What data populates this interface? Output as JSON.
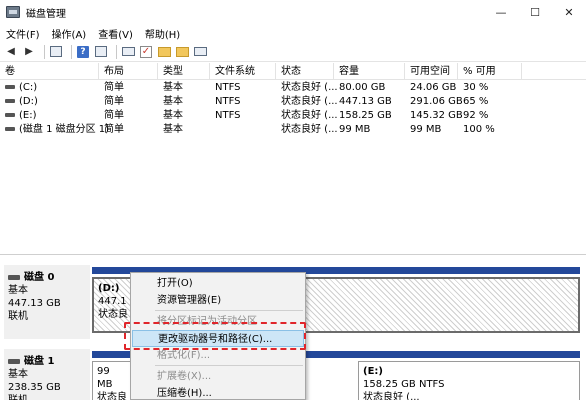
{
  "window": {
    "title": "磁盘管理",
    "min": "—",
    "max": "☐",
    "close": "✕"
  },
  "menu": [
    "文件(F)",
    "操作(A)",
    "查看(V)",
    "帮助(H)"
  ],
  "toolbar": {
    "back": "◀",
    "forward": "▶"
  },
  "columns": [
    "卷",
    "布局",
    "类型",
    "文件系统",
    "状态",
    "容量",
    "可用空间",
    "% 可用"
  ],
  "rows": [
    {
      "vol": "(C:)",
      "layout": "简单",
      "type": "基本",
      "fs": "NTFS",
      "status": "状态良好 (...",
      "cap": "80.00 GB",
      "free": "24.06 GB",
      "pct": "30 %"
    },
    {
      "vol": "(D:)",
      "layout": "简单",
      "type": "基本",
      "fs": "NTFS",
      "status": "状态良好 (...",
      "cap": "447.13 GB",
      "free": "291.06 GB",
      "pct": "65 %"
    },
    {
      "vol": "(E:)",
      "layout": "简单",
      "type": "基本",
      "fs": "NTFS",
      "status": "状态良好 (...",
      "cap": "158.25 GB",
      "free": "145.32 GB",
      "pct": "92 %"
    },
    {
      "vol": "(磁盘 1 磁盘分区 1)",
      "layout": "简单",
      "type": "基本",
      "fs": "",
      "status": "状态良好 (...",
      "cap": "99 MB",
      "free": "99 MB",
      "pct": "100 %"
    }
  ],
  "disk0": {
    "name": "磁盘 0",
    "type": "基本",
    "size": "447.13 GB",
    "state": "联机",
    "part_label": "(D:)",
    "part_size": "447.1",
    "part_status": "状态良"
  },
  "disk1": {
    "name": "磁盘 1",
    "type": "基本",
    "size": "238.35 GB",
    "state": "联机",
    "p1_size": "99 MB",
    "p1_status": "状态良好",
    "p2_label": "(E:)",
    "p2_size": "158.25 GB NTFS",
    "p2_status": "状态良好 (..."
  },
  "context_menu": {
    "open": "打开(O)",
    "explore": "资源管理器(E)",
    "mark_active": "将分区标记为活动分区",
    "change_letter": "更改驱动器号和路径(C)...",
    "format": "格式化(F)...",
    "extend": "扩展卷(X)...",
    "shrink": "压缩卷(H)..."
  },
  "colors": {
    "bar": "#23489a",
    "highlight": "#cde6f7",
    "annotation": "#e0252a"
  }
}
